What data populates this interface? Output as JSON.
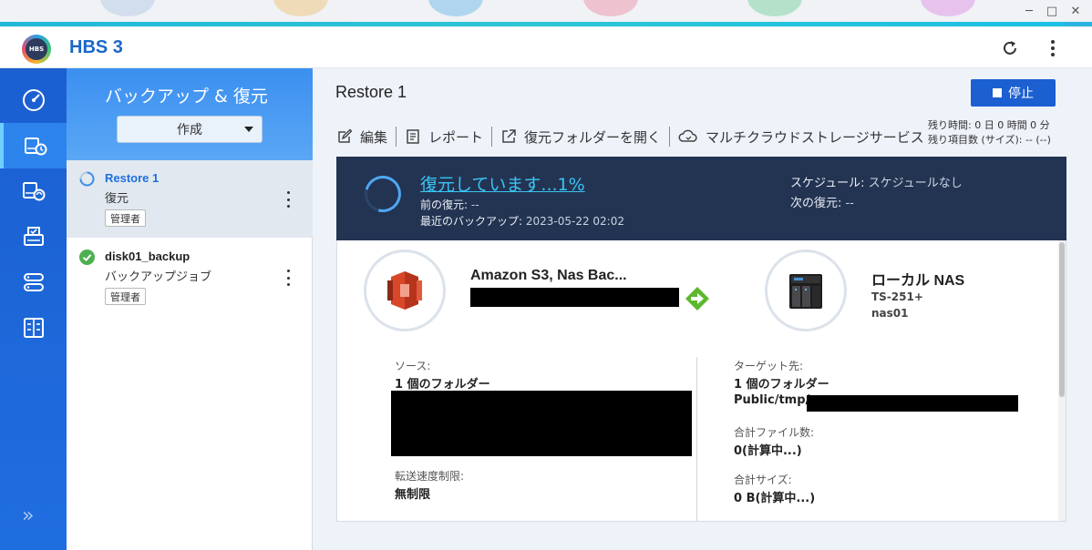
{
  "app": {
    "title": "HBS 3",
    "logo_text": "HBS"
  },
  "nav": {
    "items": [
      {
        "name": "nav-overview",
        "icon": "speedometer-icon"
      },
      {
        "name": "nav-backup-restore",
        "icon": "restore-icon",
        "active": true
      },
      {
        "name": "nav-sync",
        "icon": "sync-icon"
      },
      {
        "name": "nav-storage",
        "icon": "storage-icon"
      },
      {
        "name": "nav-services",
        "icon": "services-icon"
      },
      {
        "name": "nav-logs",
        "icon": "logs-icon"
      }
    ],
    "expand_label": "»"
  },
  "job_panel": {
    "title": "バックアップ & 復元",
    "create_label": "作成",
    "jobs": [
      {
        "name": "Restore 1",
        "type": "復元",
        "badge": "管理者",
        "status": "running"
      },
      {
        "name": "disk01_backup",
        "type": "バックアップジョブ",
        "badge": "管理者",
        "status": "success"
      }
    ]
  },
  "main": {
    "title": "Restore 1",
    "stop_label": "停止",
    "remaining_time": "残り時間: 0 日 0 時間 0 分",
    "remaining_items": "残り項目数 (サイズ): -- (--)",
    "toolbar": {
      "edit": "編集",
      "report": "レポート",
      "open_folder": "復元フォルダーを開く",
      "multicloud": "マルチクラウドストレージサービス"
    }
  },
  "status": {
    "progress_text": "復元しています...1%",
    "progress_percent": 1,
    "prev_restore_label": "前の復元: ",
    "prev_restore_value": "--",
    "last_backup_label": "最近のバックアップ: ",
    "last_backup_value": "2023-05-22 02:02",
    "schedule_label": "スケジュール: ",
    "schedule_value": "スケジュールなし",
    "next_restore_label": "次の復元: ",
    "next_restore_value": "--"
  },
  "detail": {
    "source_name": "Amazon S3, Nas Bac...",
    "dest_name": "ローカル NAS",
    "dest_model": "TS-251+",
    "dest_host": "nas01",
    "source_label": "ソース:",
    "source_value": "1 個のフォルダー",
    "speed_label": "転送速度制限:",
    "speed_value": "無制限",
    "target_label": "ターゲット先:",
    "target_value": "1 個のフォルダー",
    "target_path": "Public/tmp/",
    "total_files_label": "合計ファイル数:",
    "total_files_value": "0(計算中...)",
    "total_size_label": "合計サイズ:",
    "total_size_value": "0 B(計算中...)"
  },
  "colors": {
    "accent": "#1b5fd1",
    "nav_bg": "#1b5fd1",
    "banner_bg": "#233452",
    "link": "#39c4f4",
    "success": "#4caf50"
  }
}
